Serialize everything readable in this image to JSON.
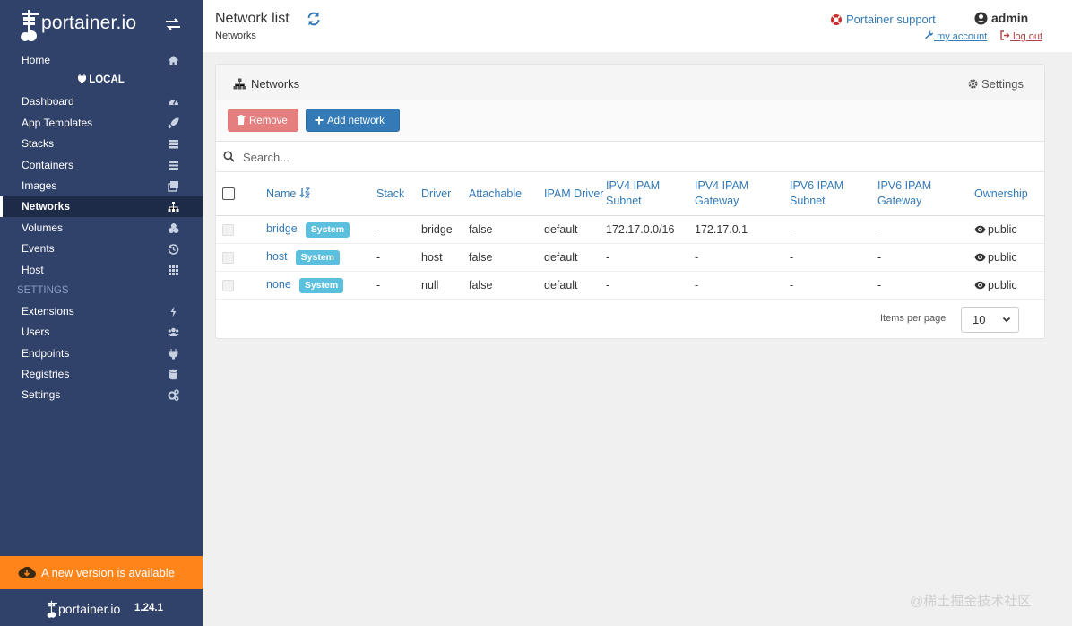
{
  "sidebar": {
    "logo_text": "portainer.io",
    "endpoint_label": "LOCAL",
    "items": [
      {
        "label": "Home",
        "icon": "home-icon"
      },
      {
        "label": "Dashboard",
        "icon": "dashboard-icon"
      },
      {
        "label": "App Templates",
        "icon": "rocket-icon"
      },
      {
        "label": "Stacks",
        "icon": "stacks-icon"
      },
      {
        "label": "Containers",
        "icon": "containers-icon"
      },
      {
        "label": "Images",
        "icon": "images-icon"
      },
      {
        "label": "Networks",
        "icon": "network-icon"
      },
      {
        "label": "Volumes",
        "icon": "volumes-icon"
      },
      {
        "label": "Events",
        "icon": "history-icon"
      },
      {
        "label": "Host",
        "icon": "grid-icon"
      }
    ],
    "section_label": "SETTINGS",
    "settings_items": [
      {
        "label": "Extensions",
        "icon": "bolt-icon"
      },
      {
        "label": "Users",
        "icon": "users-icon"
      },
      {
        "label": "Endpoints",
        "icon": "plug-icon"
      },
      {
        "label": "Registries",
        "icon": "database-icon"
      },
      {
        "label": "Settings",
        "icon": "cogs-icon"
      }
    ],
    "update_text": "A new version is available",
    "footer_logo": "portainer.io",
    "version": "1.24.1"
  },
  "header": {
    "title": "Network list",
    "breadcrumb": "Networks",
    "support_link": "Portainer support",
    "username": "admin",
    "my_account": "my account",
    "log_out": "log out"
  },
  "widget": {
    "title": "Networks",
    "settings_label": "Settings",
    "remove_label": "Remove",
    "add_label": "Add network",
    "search_placeholder": "Search...",
    "columns": [
      "Name",
      "Stack",
      "Driver",
      "Attachable",
      "IPAM Driver",
      "IPV4 IPAM Subnet",
      "IPV4 IPAM Gateway",
      "IPV6 IPAM Subnet",
      "IPV6 IPAM Gateway",
      "Ownership"
    ],
    "rows": [
      {
        "name": "bridge",
        "badge": "System",
        "stack": "-",
        "driver": "bridge",
        "attachable": "false",
        "ipam_driver": "default",
        "ipv4_subnet": "172.17.0.0/16",
        "ipv4_gateway": "172.17.0.1",
        "ipv6_subnet": "-",
        "ipv6_gateway": "-",
        "ownership": "public"
      },
      {
        "name": "host",
        "badge": "System",
        "stack": "-",
        "driver": "host",
        "attachable": "false",
        "ipam_driver": "default",
        "ipv4_subnet": "-",
        "ipv4_gateway": "-",
        "ipv6_subnet": "-",
        "ipv6_gateway": "-",
        "ownership": "public"
      },
      {
        "name": "none",
        "badge": "System",
        "stack": "-",
        "driver": "null",
        "attachable": "false",
        "ipam_driver": "default",
        "ipv4_subnet": "-",
        "ipv4_gateway": "-",
        "ipv6_subnet": "-",
        "ipv6_gateway": "-",
        "ownership": "public"
      }
    ],
    "items_per_page_label": "Items per page",
    "items_per_page_value": "10"
  },
  "watermark": "@稀土掘金技术社区",
  "colors": {
    "sidebar_bg": "#30426a",
    "link": "#337ab7",
    "update_banner": "#ff851b",
    "badge": "#5bc0de",
    "remove_button": "#e57f7f"
  }
}
